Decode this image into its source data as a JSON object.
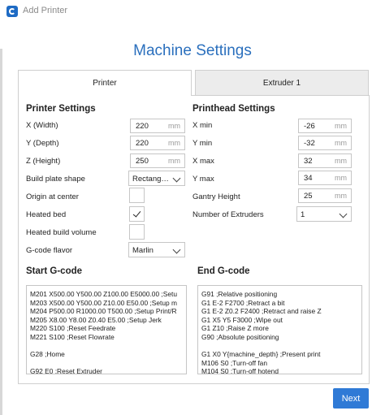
{
  "window": {
    "title": "Add Printer"
  },
  "page": {
    "heading": "Machine Settings"
  },
  "tabs": [
    {
      "label": "Printer"
    },
    {
      "label": "Extruder 1"
    }
  ],
  "printer_settings": {
    "title": "Printer Settings",
    "x_width": {
      "label": "X (Width)",
      "value": "220",
      "unit": "mm"
    },
    "y_depth": {
      "label": "Y (Depth)",
      "value": "220",
      "unit": "mm"
    },
    "z_height": {
      "label": "Z (Height)",
      "value": "250",
      "unit": "mm"
    },
    "build_plate_shape": {
      "label": "Build plate shape",
      "value": "Rectang…"
    },
    "origin_at_center": {
      "label": "Origin at center",
      "checked": false
    },
    "heated_bed": {
      "label": "Heated bed",
      "checked": true
    },
    "heated_build_volume": {
      "label": "Heated build volume",
      "checked": false
    },
    "gcode_flavor": {
      "label": "G-code flavor",
      "value": "Marlin"
    }
  },
  "printhead_settings": {
    "title": "Printhead Settings",
    "x_min": {
      "label": "X min",
      "value": "-26",
      "unit": "mm"
    },
    "y_min": {
      "label": "Y min",
      "value": "-32",
      "unit": "mm"
    },
    "x_max": {
      "label": "X max",
      "value": "32",
      "unit": "mm"
    },
    "y_max": {
      "label": "Y max",
      "value": "34",
      "unit": "mm"
    },
    "gantry_height": {
      "label": "Gantry Height",
      "value": "25",
      "unit": "mm"
    },
    "number_of_extruders": {
      "label": "Number of Extruders",
      "value": "1"
    }
  },
  "start_gcode": {
    "title": "Start G-code",
    "lines": [
      "M201 X500.00 Y500.00 Z100.00 E5000.00 ;Setu",
      "M203 X500.00 Y500.00 Z10.00 E50.00 ;Setup m",
      "M204 P500.00 R1000.00 T500.00 ;Setup Print/R",
      "M205 X8.00 Y8.00 Z0.40 E5.00 ;Setup Jerk",
      "M220 S100 ;Reset Feedrate",
      "M221 S100 ;Reset Flowrate",
      "",
      "G28 ;Home",
      "",
      "G92 E0 ;Reset Extruder"
    ]
  },
  "end_gcode": {
    "title": "End G-code",
    "lines": [
      "G91 ;Relative positioning",
      "G1 E-2 F2700 ;Retract a bit",
      "G1 E-2 Z0.2 F2400 ;Retract and raise Z",
      "G1 X5 Y5 F3000 ;Wipe out",
      "G1 Z10 ;Raise Z more",
      "G90 ;Absolute positioning",
      "",
      "G1 X0 Y{machine_depth} ;Present print",
      "M106 S0 ;Turn-off fan",
      "M104 S0 ;Turn-off hotend"
    ]
  },
  "footer": {
    "next_label": "Next"
  }
}
